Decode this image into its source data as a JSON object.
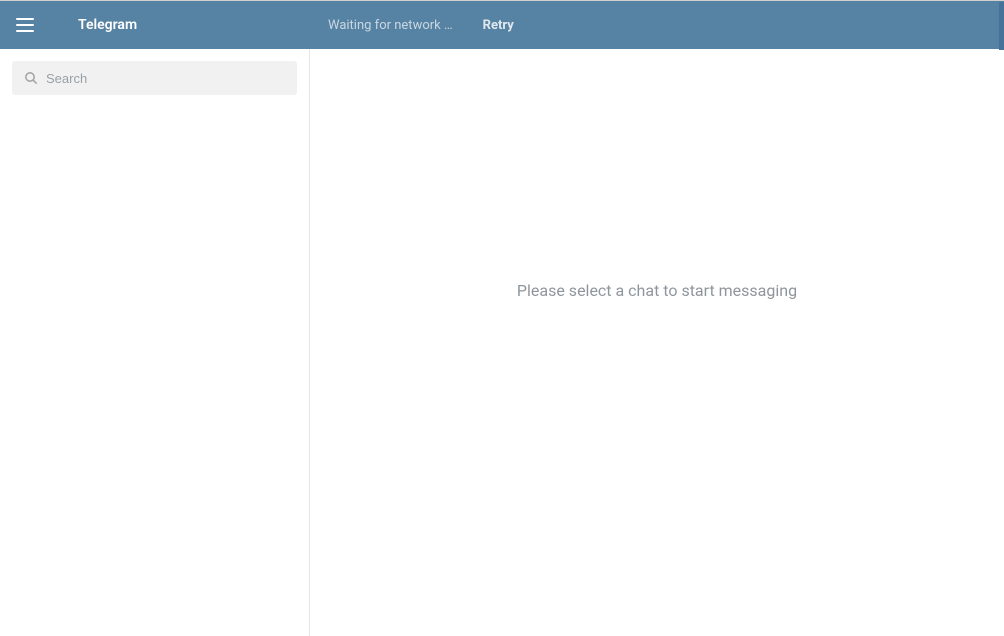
{
  "header": {
    "app_title": "Telegram",
    "status_text": "Waiting for network …",
    "retry_label": "Retry"
  },
  "sidebar": {
    "search": {
      "placeholder": "Search",
      "value": ""
    }
  },
  "main": {
    "empty_message": "Please select a chat to start messaging"
  },
  "colors": {
    "header_bg": "#5682a3",
    "header_text": "#ffffff",
    "search_bg": "#f1f1f1",
    "placeholder": "#9aa0a6",
    "empty_text": "#8e969c",
    "divider": "#e6e6e6"
  },
  "icons": {
    "menu": "hamburger-icon",
    "search": "search-icon"
  }
}
